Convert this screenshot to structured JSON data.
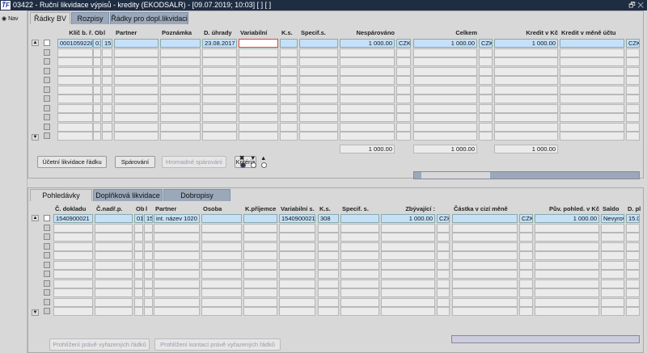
{
  "window": {
    "title": "03422 - Ruční likvidace výpisů - kredity (EKODSALR) - [09.07.2019; 10:03]  [ ]  [ ]",
    "logo": "ŤF",
    "controls": "🗗 ✕"
  },
  "nav": {
    "label": "Nav"
  },
  "top": {
    "tabs": [
      "Řádky BV",
      "Rozpisy",
      "Řádky pro dopl.likvidaci"
    ],
    "headers": [
      "Klíč b. ř.",
      "Ob",
      "l",
      "Partner",
      "Poznámka",
      "D. úhrady",
      "Variabilní",
      "K.s.",
      "Specif.s.",
      "Nespárováno",
      "",
      "Celkem",
      "",
      "Kredit v Kč",
      "Kredit v měně účtu",
      ""
    ],
    "row1": [
      "0001059228",
      "01",
      "15",
      "",
      "",
      "23.08.2017",
      "",
      "",
      "",
      "1 000.00",
      "CZK",
      "1 000.00",
      "CZK",
      "1 000.00",
      "",
      "CZK"
    ],
    "totals": {
      "nesparovano": "1 000.00",
      "celkem": "1 000.00",
      "kredit": "1 000.00"
    },
    "buttons": {
      "ucetni": "Účetní likvidace řádku",
      "sparovani": "Spárování",
      "hromadne": "Hromadné spárování",
      "kriteria": "Kritéria"
    },
    "radio_icons": [
      "✖",
      "▼",
      "▲"
    ]
  },
  "bottom": {
    "tabs": [
      "Pohledávky",
      "Doplňková likvidace",
      "Dobropisy"
    ],
    "headers": [
      "Č. dokladu",
      "Č.nadř.p.",
      "Ob",
      "l",
      "Partner",
      "Osoba",
      "K.příjemce",
      "Variabilní s.",
      "K.s.",
      "Specif. s.",
      "Zbývající :",
      "",
      "Částka v cizí měně",
      "",
      "Pův. pohled. v Kč",
      "Saldo",
      "D. pl"
    ],
    "row1": [
      "1540900021",
      "",
      "01",
      "15",
      "int. název 1020",
      "",
      "",
      "1540900021",
      "308",
      "",
      "1 000.00",
      "CZK",
      "",
      "CZK",
      "1 000.00",
      "Nevyrov",
      "15.0"
    ],
    "buttons": {
      "prohlizeni": "Prohlížení právě vyřazených řádků",
      "kontaci": "Prohlížení kontací právě vyřazených řádků"
    }
  }
}
